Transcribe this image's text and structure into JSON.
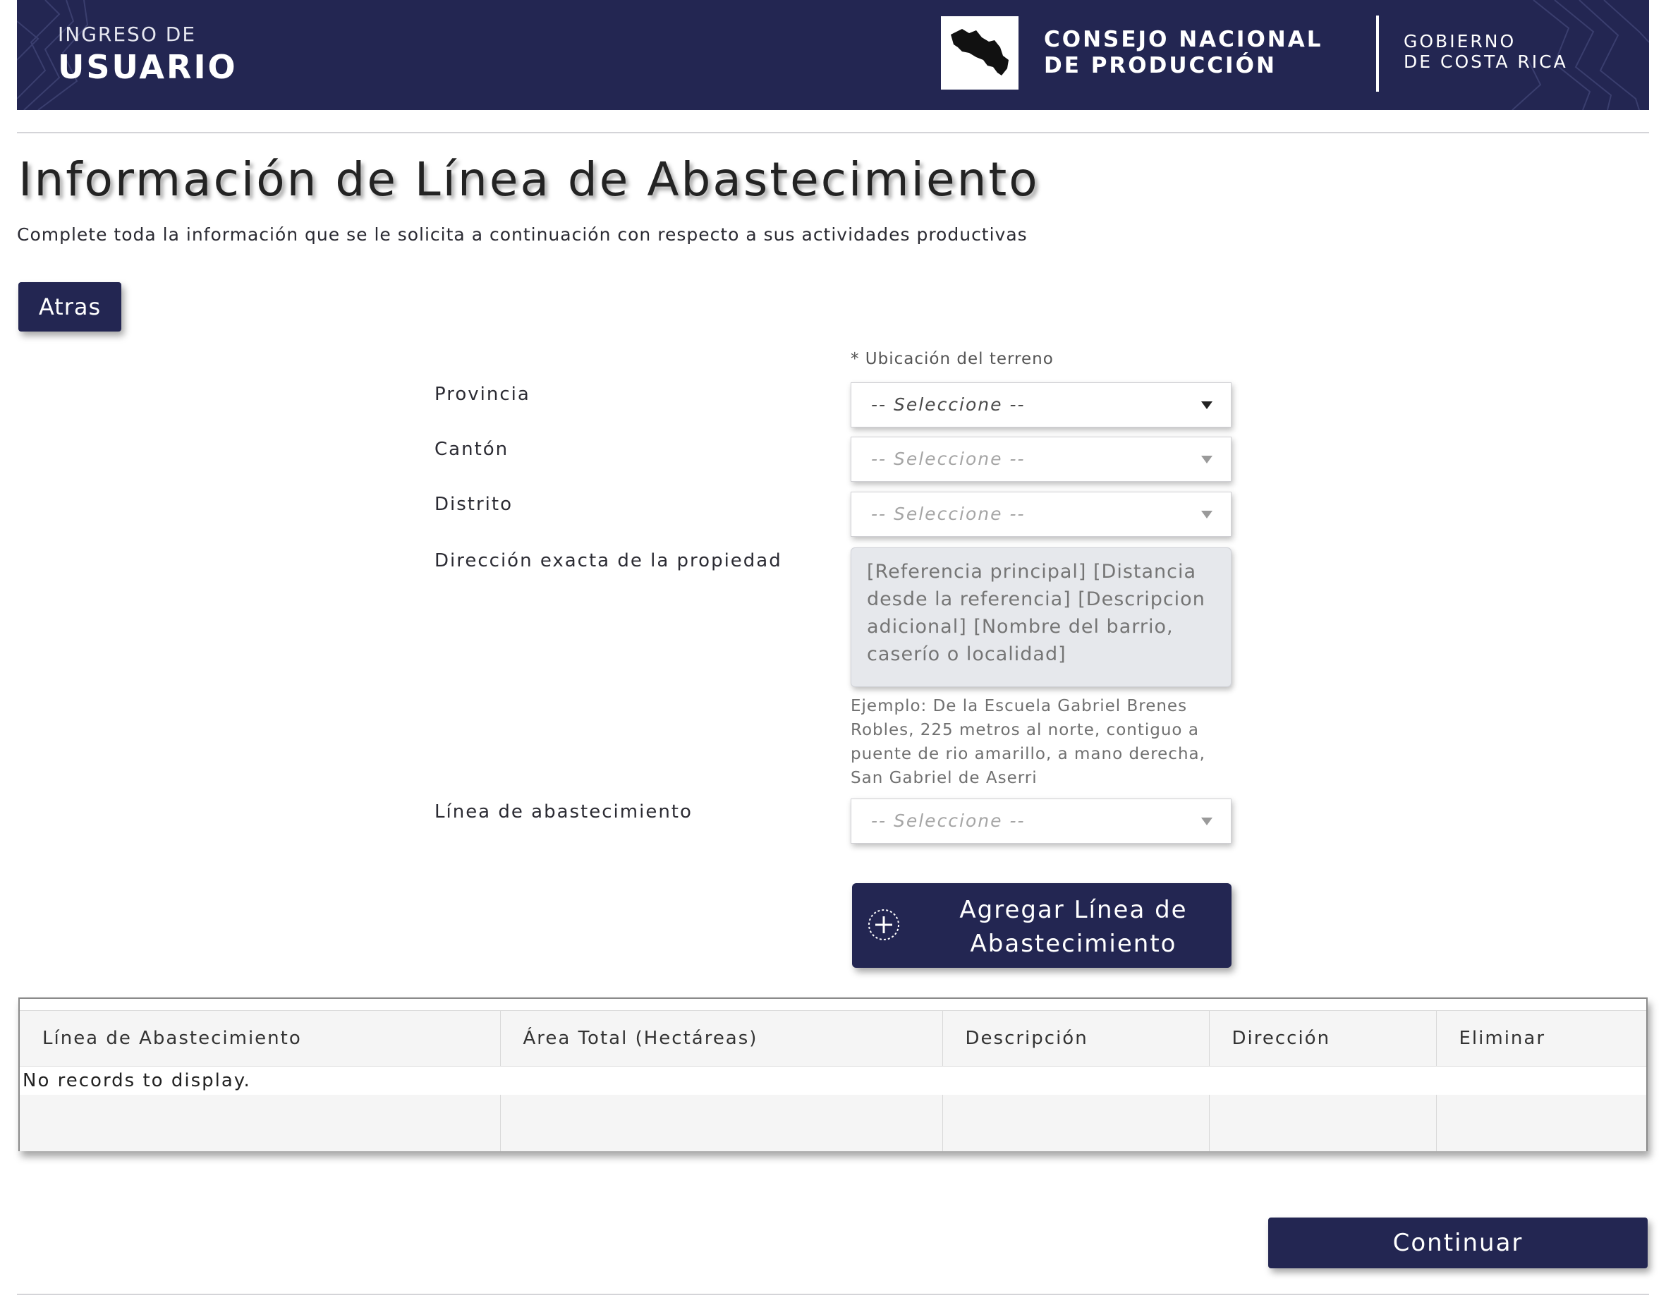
{
  "header": {
    "pretitle": "INGRESO DE",
    "title": "USUARIO",
    "org_line1": "CONSEJO NACIONAL",
    "org_line2": "DE PRODUCCIÓN",
    "gov_line1": "GOBIERNO",
    "gov_line2": "DE COSTA RICA",
    "color": "#232652"
  },
  "page": {
    "title": "Información de Línea de Abastecimiento",
    "subtitle": "Complete toda la información que se le solicita a continuación con respecto a sus actividades productivas"
  },
  "back_button": {
    "label": "Atras"
  },
  "form": {
    "note": "* Ubicación del terreno",
    "provincia": {
      "label": "Provincia",
      "value": "-- Seleccione --",
      "enabled": true
    },
    "canton": {
      "label": "Cantón",
      "value": "-- Seleccione --",
      "enabled": false
    },
    "distrito": {
      "label": "Distrito",
      "value": "-- Seleccione --",
      "enabled": false
    },
    "direccion": {
      "label": "Dirección exacta de la propiedad",
      "placeholder": "[Referencia principal] [Distancia desde la referencia] [Descripcion adicional] [Nombre del barrio, caserío o localidad]",
      "help": "Ejemplo: De la Escuela Gabriel Brenes Robles, 225 metros al norte, contiguo a puente de rio amarillo, a mano derecha, San Gabriel de Aserri"
    },
    "linea": {
      "label": "Línea de abastecimiento",
      "value": "-- Seleccione --",
      "enabled": false
    },
    "add_button": {
      "line1": "Agregar Línea de",
      "line2": "Abastecimiento"
    }
  },
  "grid": {
    "columns": [
      "Línea de Abastecimiento",
      "Área Total (Hectáreas)",
      "Descripción",
      "Dirección",
      "Eliminar"
    ],
    "empty_message": "No records to display."
  },
  "continue_button": {
    "label": "Continuar"
  }
}
